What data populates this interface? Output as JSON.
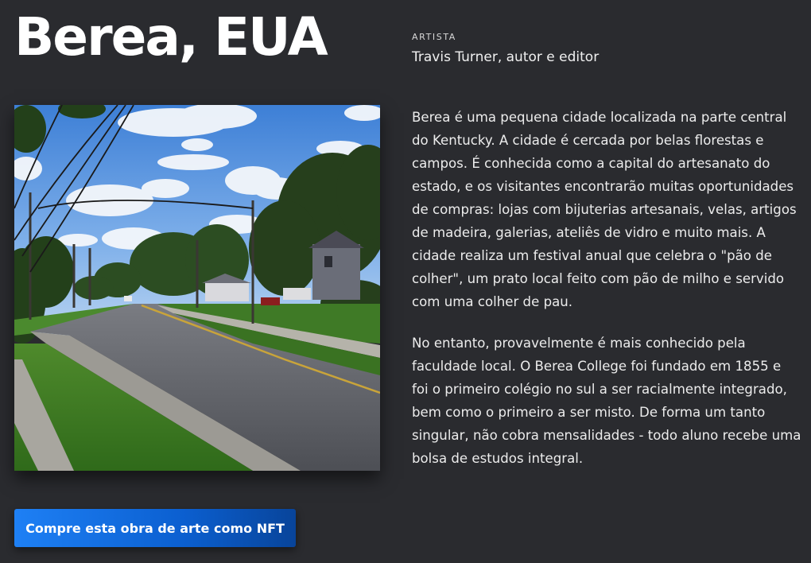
{
  "artwork": {
    "title": "Berea, EUA",
    "artist_label": "ARTISTA",
    "artist_name": "Travis Turner, autor e editor",
    "image_icon": "street-photo"
  },
  "description": {
    "paragraphs": [
      "Berea é uma pequena cidade localizada na parte central do Kentucky. A cidade é cercada por belas florestas e campos. É conhecida como a capital do artesanato do estado, e os visitantes encontrarão muitas oportunidades de compras: lojas com bijuterias artesanais, velas, artigos de madeira, galerias, ateliês de vidro e muito mais. A cidade realiza um festival anual que celebra o \"pão de colher\", um prato local feito com pão de milho e servido com uma colher de pau.",
      "No entanto, provavelmente é mais conhecido pela faculdade local. O Berea College foi fundado em 1855 e foi o primeiro colégio no sul a ser racialmente integrado, bem como o primeiro a ser misto. De forma um tanto singular, não cobra mensalidades - todo aluno recebe uma bolsa de estudos integral."
    ]
  },
  "cta": {
    "label": "Compre esta obra de arte como NFT"
  },
  "colors": {
    "background": "#2a2b2f",
    "button_start": "#1e80f5",
    "button_end": "#08449a"
  }
}
